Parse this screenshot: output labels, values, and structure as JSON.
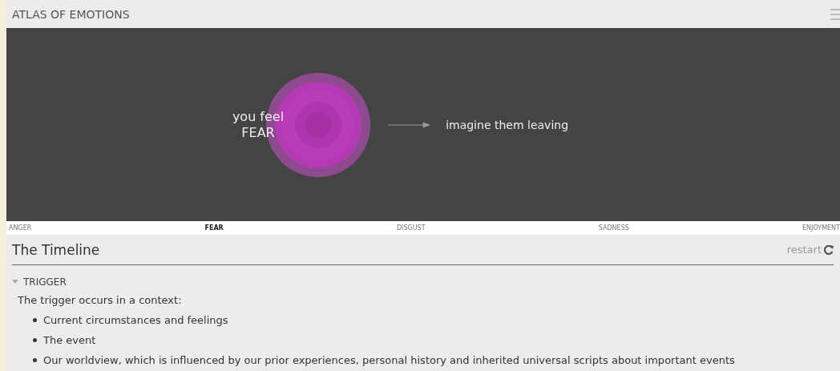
{
  "header": {
    "title": "ATLAS OF EMOTIONS"
  },
  "stage": {
    "left_line": "you feel",
    "emotion": "FEAR",
    "response": "imagine them leaving"
  },
  "tabs": [
    {
      "label": "ANGER",
      "selected": false
    },
    {
      "label": "FEAR",
      "selected": true
    },
    {
      "label": "DISGUST",
      "selected": false
    },
    {
      "label": "SADNESS",
      "selected": false
    },
    {
      "label": "ENJOYMENT",
      "selected": false
    }
  ],
  "timeline": {
    "title": "The Timeline",
    "restart": "restart"
  },
  "section": {
    "label": "TRIGGER",
    "expanded": true,
    "intro": "The trigger occurs in a context:",
    "bullets": [
      "Current circumstances and feelings",
      "The event",
      "Our worldview, which is influenced by our prior experiences, personal history and inherited universal scripts about important events"
    ]
  }
}
